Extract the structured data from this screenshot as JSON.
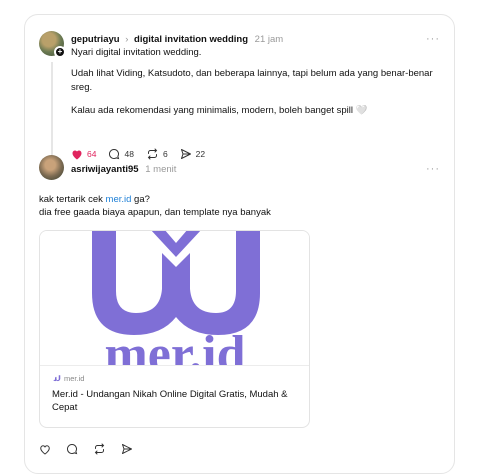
{
  "post1": {
    "username": "geputriayu",
    "separator": "›",
    "topic": "digital invitation wedding",
    "time": "21 jam",
    "more": "···",
    "text": "Nyari digital invitation wedding.",
    "quote1": "Udah lihat Viding, Katsudoto, dan beberapa lainnya, tapi belum ada yang benar-benar sreg.",
    "quote2": "Kalau ada rekomendasi yang minimalis, modern, boleh banget spill 🤍",
    "likes": "64",
    "replies": "48",
    "reposts": "6",
    "shares": "22",
    "like_color": "#e0245e"
  },
  "post2": {
    "username": "asriwijayanti95",
    "time": "1 menit",
    "more": "···",
    "text_before_link": "kak tertarik cek ",
    "link_text": "mer.id",
    "text_after_link": " ga?",
    "text_line2": "dia free gaada biaya apapun, dan template nya banyak",
    "link_color": "#1d7fd6",
    "preview": {
      "logo_text": "mer.id",
      "logo_color": "#7f6fd6",
      "domain": "mer.id",
      "title": "Mer.id - Undangan Nikah Online Digital Gratis, Mudah & Cepat"
    }
  }
}
